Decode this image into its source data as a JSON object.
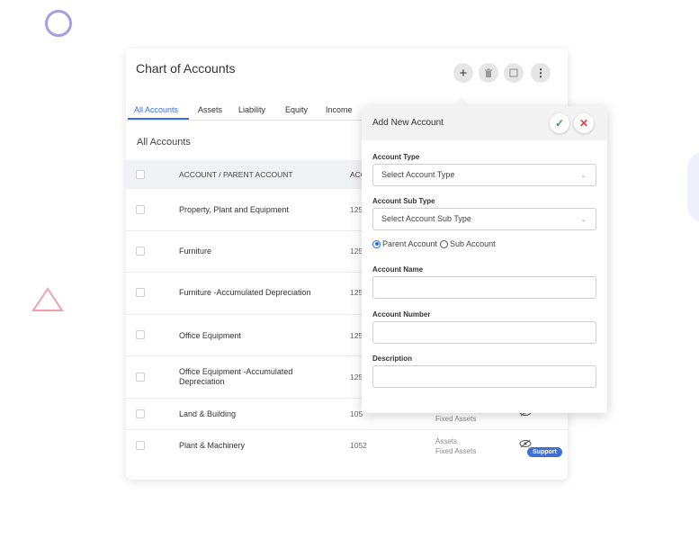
{
  "card": {
    "title": "Chart of Accounts",
    "header_buttons": {
      "add": "+",
      "delete": "🗑",
      "window": "☐",
      "more": "⋮"
    }
  },
  "tabs": [
    "All Accounts",
    "Assets",
    "Liability",
    "Equity",
    "Income"
  ],
  "section_title": "All Accounts",
  "table": {
    "columns": [
      "ACCOUNT / PARENT ACCOUNT",
      "ACC"
    ],
    "rows": [
      {
        "name": "Property, Plant and Equipment",
        "number": "125",
        "type": "",
        "subtype": ""
      },
      {
        "name": "Furniture",
        "number": "125",
        "type": "",
        "subtype": ""
      },
      {
        "name": "Furniture -Accumulated Depreciation",
        "number": "125",
        "type": "",
        "subtype": ""
      },
      {
        "name": "Office Equipment",
        "number": "125",
        "type": "",
        "subtype": ""
      },
      {
        "name": "Office Equipment -Accumulated Depreciation",
        "number": "125",
        "type": "",
        "subtype": ""
      },
      {
        "name": "Land & Building",
        "number": "105",
        "type": "",
        "subtype": "Fixed Assets"
      },
      {
        "name": "Plant & Machinery",
        "number": "1052",
        "type": "Assets",
        "subtype": "Fixed Assets"
      }
    ],
    "support_badge": "Support"
  },
  "popup": {
    "title": "Add New Account",
    "confirm_icon": "✓",
    "close_icon": "✕",
    "account_type": {
      "label": "Account Type",
      "placeholder": "Select Account Type"
    },
    "account_sub_type": {
      "label": "Account Sub Type",
      "placeholder": "Select Account Sub Type"
    },
    "radio": {
      "parent": "Parent Account",
      "sub": "Sub Account",
      "selected": "parent"
    },
    "account_name": {
      "label": "Account Name",
      "value": ""
    },
    "account_number": {
      "label": "Account Number",
      "value": ""
    },
    "description": {
      "label": "Description",
      "value": ""
    }
  },
  "colors": {
    "accent": "#3e6fd1",
    "confirm": "#29a745",
    "cancel": "#e0413b"
  }
}
